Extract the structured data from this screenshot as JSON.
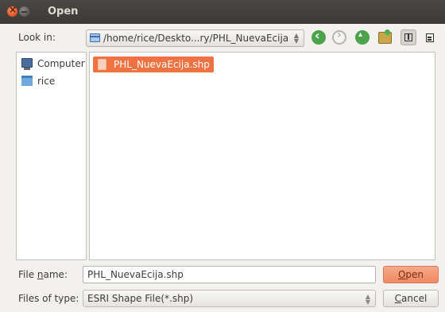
{
  "window": {
    "title": "Open"
  },
  "look_in": {
    "label": "Look in:",
    "path": "/home/rice/Deskto...ry/PHL_NuevaEcija"
  },
  "toolbar": {
    "icons": [
      "back-icon",
      "forward-icon",
      "up-icon",
      "new-folder-icon",
      "list-view-icon",
      "detail-view-icon"
    ]
  },
  "sidebar": {
    "items": [
      {
        "label": "Computer",
        "icon": "computer-icon"
      },
      {
        "label": "rice",
        "icon": "home-folder-icon"
      }
    ]
  },
  "files": [
    {
      "name": "PHL_NuevaEcija.shp",
      "selected": true,
      "icon": "file-icon"
    }
  ],
  "file_name": {
    "label_pre": "File ",
    "label_u": "n",
    "label_post": "ame:",
    "value": "PHL_NuevaEcija.shp"
  },
  "file_type": {
    "label": "Files of type:",
    "value": "ESRI Shape File(*.shp)"
  },
  "buttons": {
    "open_u": "O",
    "open_rest": "pen",
    "cancel_u": "C",
    "cancel_rest": "ancel"
  },
  "colors": {
    "selection": "#ef7243",
    "titlebar": "#3c3b37",
    "accent_open": "#ee8a62"
  }
}
